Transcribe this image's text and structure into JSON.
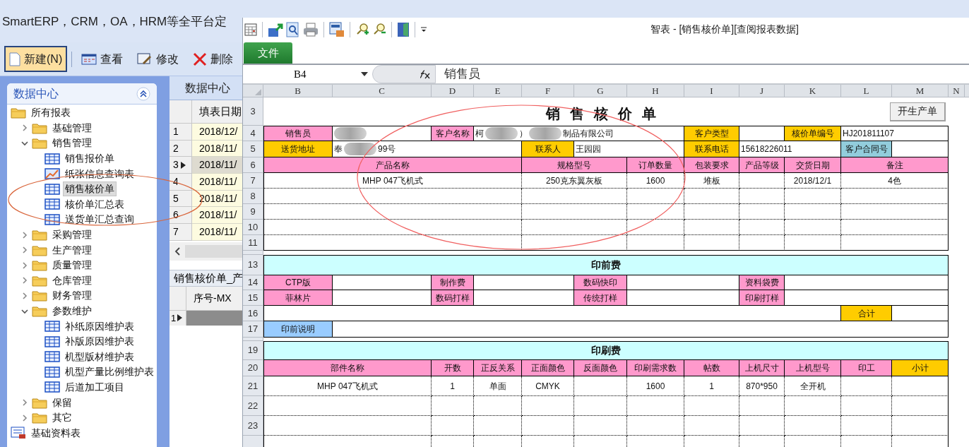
{
  "background_app": {
    "title": "SmartERP，CRM，OA，HRM等全平台定",
    "toolbar": [
      {
        "label": "新建(N)",
        "kind": "new",
        "selected": true
      },
      {
        "label": "查看",
        "kind": "view",
        "selected": false
      },
      {
        "label": "修改",
        "kind": "edit",
        "selected": false
      },
      {
        "label": "删除",
        "kind": "delete",
        "selected": false
      }
    ]
  },
  "navigator": {
    "title": "数据中心",
    "tree": [
      {
        "label": "所有报表",
        "kind": "folder",
        "selected": false,
        "children": [
          {
            "label": "基础管理",
            "kind": "folder",
            "expanded": false,
            "selected": false
          },
          {
            "label": "销售管理",
            "kind": "folder",
            "expanded": true,
            "selected": false,
            "children": [
              {
                "label": "销售报价单",
                "kind": "table",
                "selected": false
              },
              {
                "label": "纸张信息查询表",
                "kind": "chart",
                "selected": false
              },
              {
                "label": "销售核价单",
                "kind": "table",
                "selected": true
              },
              {
                "label": "核价单汇总表",
                "kind": "table",
                "selected": false
              },
              {
                "label": "送货单汇总查询",
                "kind": "table",
                "selected": false
              }
            ]
          },
          {
            "label": "采购管理",
            "kind": "folder",
            "expanded": false,
            "selected": false
          },
          {
            "label": "生产管理",
            "kind": "folder",
            "expanded": false,
            "selected": false
          },
          {
            "label": "质量管理",
            "kind": "folder",
            "expanded": false,
            "selected": false
          },
          {
            "label": "仓库管理",
            "kind": "folder",
            "expanded": false,
            "selected": false
          },
          {
            "label": "财务管理",
            "kind": "folder",
            "expanded": false,
            "selected": false
          },
          {
            "label": "参数维护",
            "kind": "folder",
            "expanded": true,
            "selected": false,
            "children": [
              {
                "label": "补纸原因维护表",
                "kind": "table",
                "selected": false
              },
              {
                "label": "补版原因维护表",
                "kind": "table",
                "selected": false
              },
              {
                "label": "机型版材维护表",
                "kind": "table",
                "selected": false
              },
              {
                "label": "机型产量比例维护表",
                "kind": "table",
                "selected": false
              },
              {
                "label": "后道加工项目",
                "kind": "table",
                "selected": false
              }
            ]
          },
          {
            "label": "保留",
            "kind": "folder",
            "expanded": false,
            "selected": false
          },
          {
            "label": "其它",
            "kind": "folder",
            "expanded": false,
            "selected": false
          }
        ]
      },
      {
        "label": "基础资料表",
        "kind": "report",
        "selected": false
      }
    ]
  },
  "data_panel": {
    "tab": "数据中心",
    "columns": [
      "填表日期"
    ],
    "rows": [
      {
        "number": "1",
        "date": "2018/12/",
        "selected": false
      },
      {
        "number": "2",
        "date": "2018/11/",
        "selected": false
      },
      {
        "number": "3",
        "date": "2018/11/",
        "selected": true
      },
      {
        "number": "4",
        "date": "2018/11/",
        "selected": false
      },
      {
        "number": "5",
        "date": "2018/11/",
        "selected": false
      },
      {
        "number": "6",
        "date": "2018/11/",
        "selected": false
      },
      {
        "number": "7",
        "date": "2018/11/",
        "selected": false
      }
    ],
    "detail": {
      "title": "销售核价单_产",
      "columns": [
        "序号-MX"
      ],
      "rows": [
        {
          "number": "1",
          "selected": true
        }
      ]
    }
  },
  "report_window": {
    "title": "智表 - [销售核价单][查阅报表数据]",
    "ribbon_tab": "文件",
    "name_box": "B4",
    "formula": "销售员",
    "columns": [
      "B",
      "C",
      "D",
      "E",
      "F",
      "G",
      "H",
      "I",
      "J",
      "K",
      "L",
      "M",
      "N"
    ],
    "sheet_title": "销售核价单",
    "button": "开生产单",
    "rows": [
      {
        "number": "3"
      },
      {
        "number": "4",
        "cells": [
          {
            "text": "销售员",
            "kind": "pink"
          },
          {
            "kind": "value",
            "redacted": true
          },
          {
            "text": "客户名称",
            "kind": "pink"
          },
          {
            "parts": [
              "柯",
              "）",
              "制品有限公司"
            ],
            "kind": "value",
            "redacted": true
          },
          {
            "text": "客户类型",
            "kind": "gold"
          },
          {
            "text": "核价单编号",
            "kind": "gold"
          },
          {
            "text": "HJ201811107",
            "kind": "value"
          }
        ]
      },
      {
        "number": "5",
        "cells": [
          {
            "text": "送货地址",
            "kind": "gold"
          },
          {
            "parts": [
              "奉",
              "99号"
            ],
            "kind": "value",
            "redacted": true
          },
          {
            "text": "联系人",
            "kind": "gold"
          },
          {
            "text": "王园园",
            "kind": "value"
          },
          {
            "text": "联系电话",
            "kind": "gold"
          },
          {
            "text": "15618226011",
            "kind": "value"
          },
          {
            "text": "客户合同号",
            "kind": "teal"
          }
        ]
      },
      {
        "number": "6",
        "cells": [
          {
            "text": "产品名称",
            "kind": "pink"
          },
          {
            "text": "规格型号",
            "kind": "pink"
          },
          {
            "text": "订单数量",
            "kind": "pink"
          },
          {
            "text": "包装要求",
            "kind": "pink"
          },
          {
            "text": "产品等级",
            "kind": "pink"
          },
          {
            "text": "交货日期",
            "kind": "pink"
          },
          {
            "text": "备注",
            "kind": "pink"
          }
        ]
      },
      {
        "number": "7",
        "cells": [
          {
            "text": "MHP 047飞机式",
            "kind": "value"
          },
          {
            "text": "250克东翼灰板",
            "kind": "value"
          },
          {
            "text": "1600",
            "kind": "value"
          },
          {
            "text": "堆板",
            "kind": "value"
          },
          {
            "text": "2018/12/1",
            "kind": "value"
          },
          {
            "text": "4色",
            "kind": "value"
          }
        ]
      },
      {
        "number": "8"
      },
      {
        "number": "9"
      },
      {
        "number": "10"
      },
      {
        "number": "11"
      },
      {
        "number": "13",
        "cells": [
          {
            "text": "印前费",
            "kind": "cyan"
          }
        ]
      },
      {
        "number": "14",
        "cells": [
          {
            "text": "CTP版",
            "kind": "pink"
          },
          {
            "text": "制作费",
            "kind": "pink"
          },
          {
            "text": "数码快印",
            "kind": "pink"
          },
          {
            "text": "资料袋费",
            "kind": "pink"
          }
        ]
      },
      {
        "number": "15",
        "cells": [
          {
            "text": "菲林片",
            "kind": "pink"
          },
          {
            "text": "数码打样",
            "kind": "pink"
          },
          {
            "text": "传统打样",
            "kind": "pink"
          },
          {
            "text": "印刷打样",
            "kind": "pink"
          }
        ]
      },
      {
        "number": "16",
        "cells": [
          {
            "text": "合计",
            "kind": "gold"
          }
        ]
      },
      {
        "number": "17",
        "cells": [
          {
            "text": "印前说明",
            "kind": "sky"
          }
        ]
      },
      {
        "number": "19",
        "cells": [
          {
            "text": "印刷费",
            "kind": "cyan"
          }
        ]
      },
      {
        "number": "20",
        "cells": [
          {
            "text": "部件名称",
            "kind": "pink"
          },
          {
            "text": "开数",
            "kind": "pink"
          },
          {
            "text": "正反关系",
            "kind": "pink"
          },
          {
            "text": "正面颜色",
            "kind": "pink"
          },
          {
            "text": "反面颜色",
            "kind": "pink"
          },
          {
            "text": "印刷需求数",
            "kind": "pink"
          },
          {
            "text": "帖数",
            "kind": "pink"
          },
          {
            "text": "上机尺寸",
            "kind": "pink"
          },
          {
            "text": "上机型号",
            "kind": "pink"
          },
          {
            "text": "印工",
            "kind": "pink"
          },
          {
            "text": "小计",
            "kind": "gold"
          }
        ]
      },
      {
        "number": "21",
        "cells": [
          {
            "text": "MHP 047飞机式",
            "kind": "value"
          },
          {
            "text": "1",
            "kind": "value"
          },
          {
            "text": "单面",
            "kind": "value"
          },
          {
            "text": "CMYK",
            "kind": "value"
          },
          {
            "text": "1600",
            "kind": "value"
          },
          {
            "text": "1",
            "kind": "value"
          },
          {
            "text": "870*950",
            "kind": "value"
          },
          {
            "text": "全开机",
            "kind": "value"
          }
        ]
      },
      {
        "number": "22"
      },
      {
        "number": "23"
      }
    ]
  }
}
